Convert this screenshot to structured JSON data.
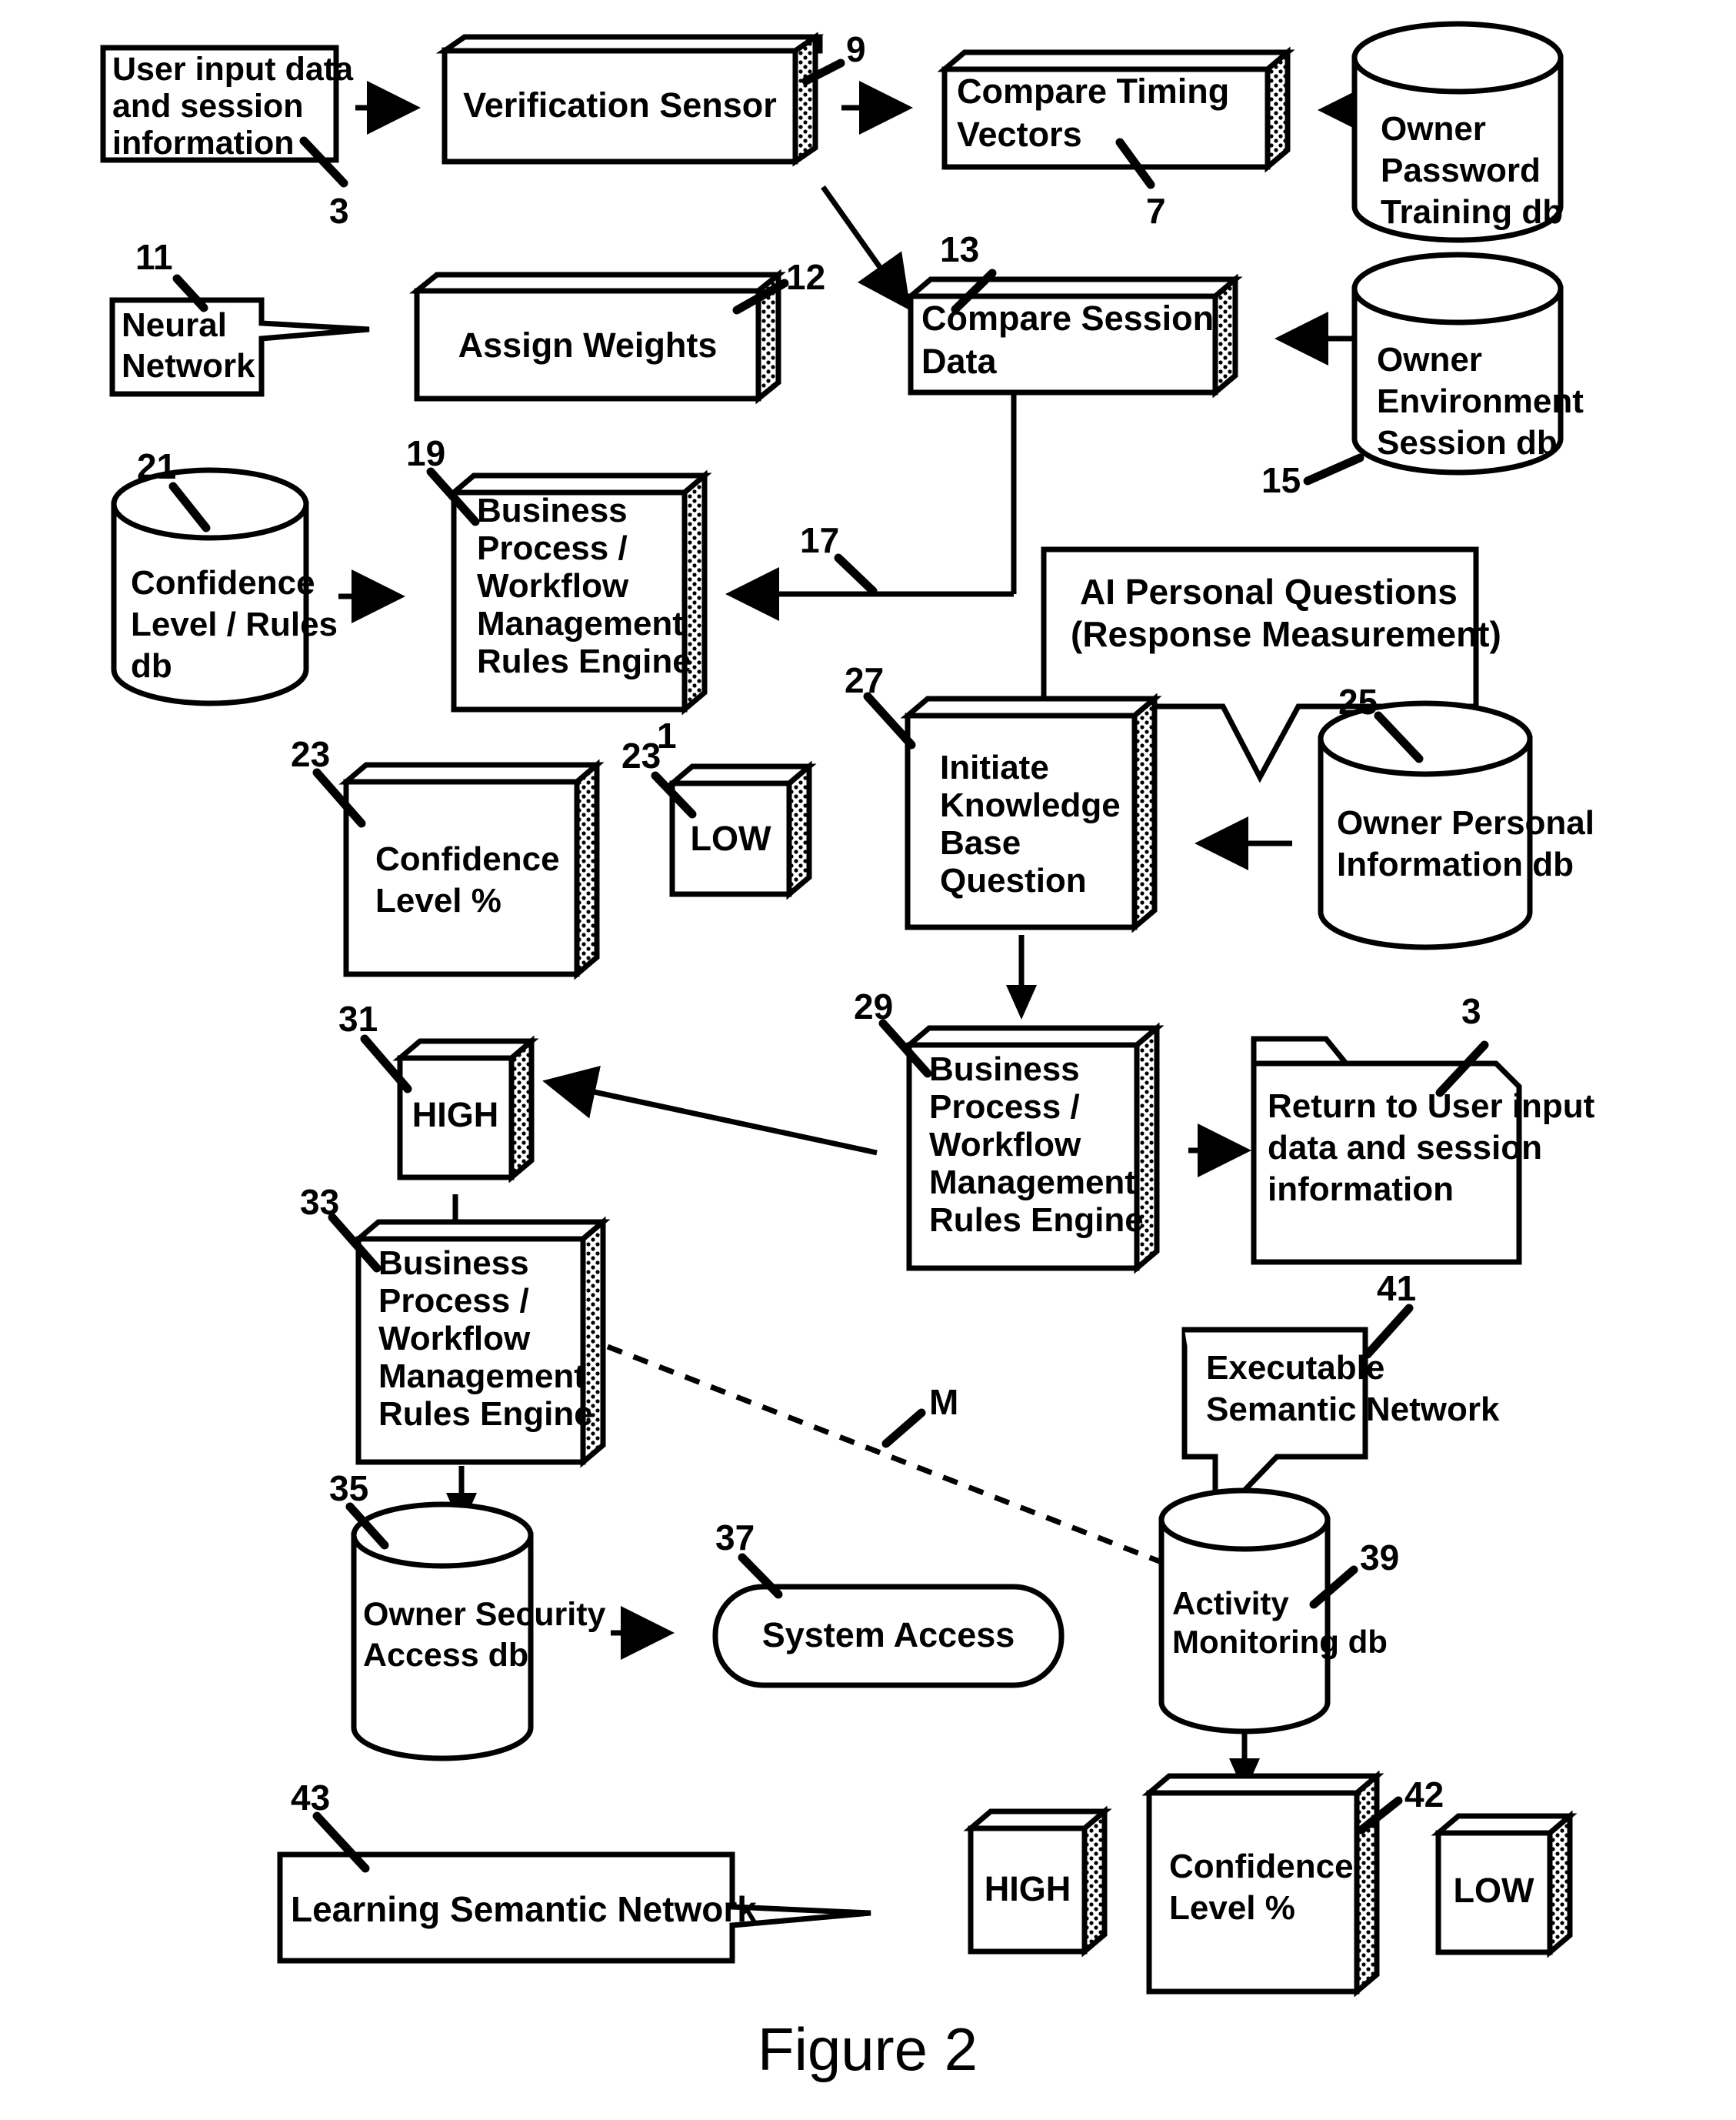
{
  "figure": {
    "caption": "Figure 2"
  },
  "nodes": [
    {
      "id": "n3a",
      "label": "User input data and session information",
      "ref": "3",
      "shape": "box"
    },
    {
      "id": "n9",
      "label": "Verification Sensor",
      "ref": "9",
      "shape": "block3d"
    },
    {
      "id": "n7",
      "label": "Compare Timing Vectors",
      "ref": "7",
      "shape": "block3d"
    },
    {
      "id": "ndb1",
      "label": "Owner Password Training db",
      "ref": "",
      "shape": "cylinder"
    },
    {
      "id": "n11",
      "label": "Neural Network",
      "ref": "11",
      "shape": "callout"
    },
    {
      "id": "n12",
      "label": "Assign Weights",
      "ref": "12",
      "shape": "block3d"
    },
    {
      "id": "n13",
      "label": "Compare Session Data",
      "ref": "13",
      "shape": "block3d"
    },
    {
      "id": "ndb2",
      "label": "Owner Environment Session db",
      "ref": "15",
      "shape": "cylinder"
    },
    {
      "id": "n21",
      "label": "Confidence Level / Rules db",
      "ref": "21",
      "shape": "cylinder"
    },
    {
      "id": "n19",
      "label": "Business Process / Workflow Management Rules Engine",
      "ref": "19",
      "shape": "block3d"
    },
    {
      "id": "n17",
      "label": "",
      "ref": "17",
      "shape": "connector"
    },
    {
      "id": "nai",
      "label": "AI Personal Questions (Response Measurement)",
      "ref": "",
      "shape": "callout"
    },
    {
      "id": "n23",
      "label": "Confidence Level %",
      "ref": "23",
      "shape": "block3d"
    },
    {
      "id": "n23a",
      "label": "LOW",
      "ref": "23",
      "refsup": "1",
      "shape": "block3d"
    },
    {
      "id": "n27",
      "label": "Initiate Knowledge Base Question",
      "ref": "27",
      "shape": "block3d"
    },
    {
      "id": "n25",
      "label": "Owner Personal Information db",
      "ref": "25",
      "shape": "cylinder"
    },
    {
      "id": "n31",
      "label": "HIGH",
      "ref": "31",
      "shape": "block3d"
    },
    {
      "id": "n29",
      "label": "Business Process / Workflow Management Rules Engine",
      "ref": "29",
      "shape": "block3d"
    },
    {
      "id": "n3b",
      "label": "Return to User input data and session information",
      "ref": "3",
      "shape": "folder"
    },
    {
      "id": "n33",
      "label": "Business Process / Workflow Management Rules Engine",
      "ref": "33",
      "shape": "block3d"
    },
    {
      "id": "n41",
      "label": "Executable Semantic Network",
      "ref": "41",
      "shape": "callout"
    },
    {
      "id": "n35",
      "label": "Owner Security Access db",
      "ref": "35",
      "shape": "cylinder"
    },
    {
      "id": "n37",
      "label": "System Access",
      "ref": "37",
      "shape": "rounded"
    },
    {
      "id": "n39",
      "label": "Activity Monitoring db",
      "ref": "39",
      "shape": "cylinder"
    },
    {
      "id": "n43",
      "label": "Learning Semantic Network",
      "ref": "43",
      "shape": "callout"
    },
    {
      "id": "nhigh2",
      "label": "HIGH",
      "ref": "",
      "shape": "block3d"
    },
    {
      "id": "n42",
      "label": "Confidence Level %",
      "ref": "42",
      "shape": "block3d"
    },
    {
      "id": "nlow2",
      "label": "LOW",
      "ref": "",
      "shape": "block3d"
    }
  ],
  "edge_labels": {
    "m": "M"
  },
  "node_text": {
    "user_input_l1": "User input data",
    "user_input_l2": "and session",
    "user_input_l3": "information",
    "verification_sensor": "Verification Sensor",
    "compare_timing_l1": "Compare Timing",
    "compare_timing_l2": "Vectors",
    "owner_password_l1": "Owner",
    "owner_password_l2": "Password",
    "owner_password_l3": "Training db",
    "neural_l1": "Neural",
    "neural_l2": "Network",
    "assign_weights": "Assign Weights",
    "compare_session_l1": "Compare Session",
    "compare_session_l2": "Data",
    "owner_env_l1": "Owner",
    "owner_env_l2": "Environment",
    "owner_env_l3": "Session db",
    "conf_rules_l1": "Confidence",
    "conf_rules_l2": "Level / Rules",
    "conf_rules_l3": "db",
    "bpm_l1": "Business",
    "bpm_l2": "Process /",
    "bpm_l3": "Workflow",
    "bpm_l4": "Management",
    "bpm_l5": "Rules Engine",
    "ai_q_l1": "AI Personal Questions",
    "ai_q_l2": "(Response Measurement)",
    "conf_level_l1": "Confidence",
    "conf_level_l2": "Level %",
    "low": "LOW",
    "high": "HIGH",
    "initiate_l1": "Initiate",
    "initiate_l2": "Knowledge",
    "initiate_l3": "Base",
    "initiate_l4": "Question",
    "owner_personal_l1": "Owner Personal",
    "owner_personal_l2": "Information db",
    "return_l1": "Return to User input",
    "return_l2": "data and session",
    "return_l3": "information",
    "exec_sem_l1": "Executable",
    "exec_sem_l2": "Semantic Network",
    "owner_sec_l1": "Owner Security",
    "owner_sec_l2": "Access db",
    "system_access": "System Access",
    "activity_l1": "Activity",
    "activity_l2": "Monitoring db",
    "learning_sem": "Learning Semantic Network"
  },
  "ref_numbers": {
    "r3_top": "3",
    "r9": "9",
    "r7": "7",
    "r11": "11",
    "r12": "12",
    "r13": "13",
    "r15": "15",
    "r21": "21",
    "r19": "19",
    "r17": "17",
    "r25": "25",
    "r27": "27",
    "r23": "23",
    "r23_1": "23",
    "r23_sup": "1",
    "r29": "29",
    "r31": "31",
    "r3_mid": "3",
    "r33": "33",
    "r35": "35",
    "r37": "37",
    "r39": "39",
    "r41": "41",
    "r42": "42",
    "r43": "43",
    "rM": "M"
  },
  "colors": {
    "stroke": "#000000",
    "fill": "#ffffff"
  }
}
